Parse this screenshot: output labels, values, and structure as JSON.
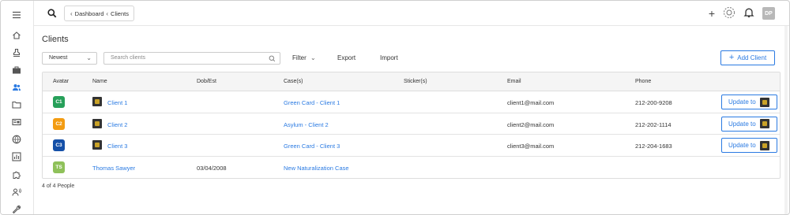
{
  "breadcrumb": {
    "items": [
      "Dashboard",
      "Clients"
    ]
  },
  "topbar": {
    "user_initials": "DP"
  },
  "page": {
    "title": "Clients",
    "footer": "4 of 4 People"
  },
  "toolbar": {
    "sort_value": "Newest",
    "search_placeholder": "Search clients",
    "filter_label": "Filter",
    "export_label": "Export",
    "import_label": "Import",
    "add_label": "Add Client"
  },
  "table": {
    "columns": [
      "Avatar",
      "Name",
      "Dob/Est",
      "Case(s)",
      "Sticker(s)",
      "Email",
      "Phone"
    ],
    "update_label": "Update to",
    "rows": [
      {
        "initials": "C1",
        "avatar_color": "#27a05a",
        "name": "Client 1",
        "dob": "",
        "case": "Green Card - Client 1",
        "sticker": "",
        "email": "client1@mail.com",
        "phone": "212-200-9208",
        "has_logo": true,
        "has_update": true
      },
      {
        "initials": "C2",
        "avatar_color": "#f39c12",
        "name": "Client 2",
        "dob": "",
        "case": "Asylum - Client 2",
        "sticker": "",
        "email": "client2@mail.com",
        "phone": "212-202-1114",
        "has_logo": true,
        "has_update": true
      },
      {
        "initials": "C3",
        "avatar_color": "#1550a8",
        "name": "Client 3",
        "dob": "",
        "case": "Green Card - Client 3",
        "sticker": "",
        "email": "client3@mail.com",
        "phone": "212-204-1683",
        "has_logo": true,
        "has_update": true
      },
      {
        "initials": "TS",
        "avatar_color": "#8fc15a",
        "name": "Thomas Sawyer",
        "dob": "03/04/2008",
        "case": "New Naturalization Case",
        "sticker": "",
        "email": "",
        "phone": "",
        "has_logo": false,
        "has_update": false
      }
    ]
  },
  "colors": {
    "accent": "#2a7ae2"
  }
}
